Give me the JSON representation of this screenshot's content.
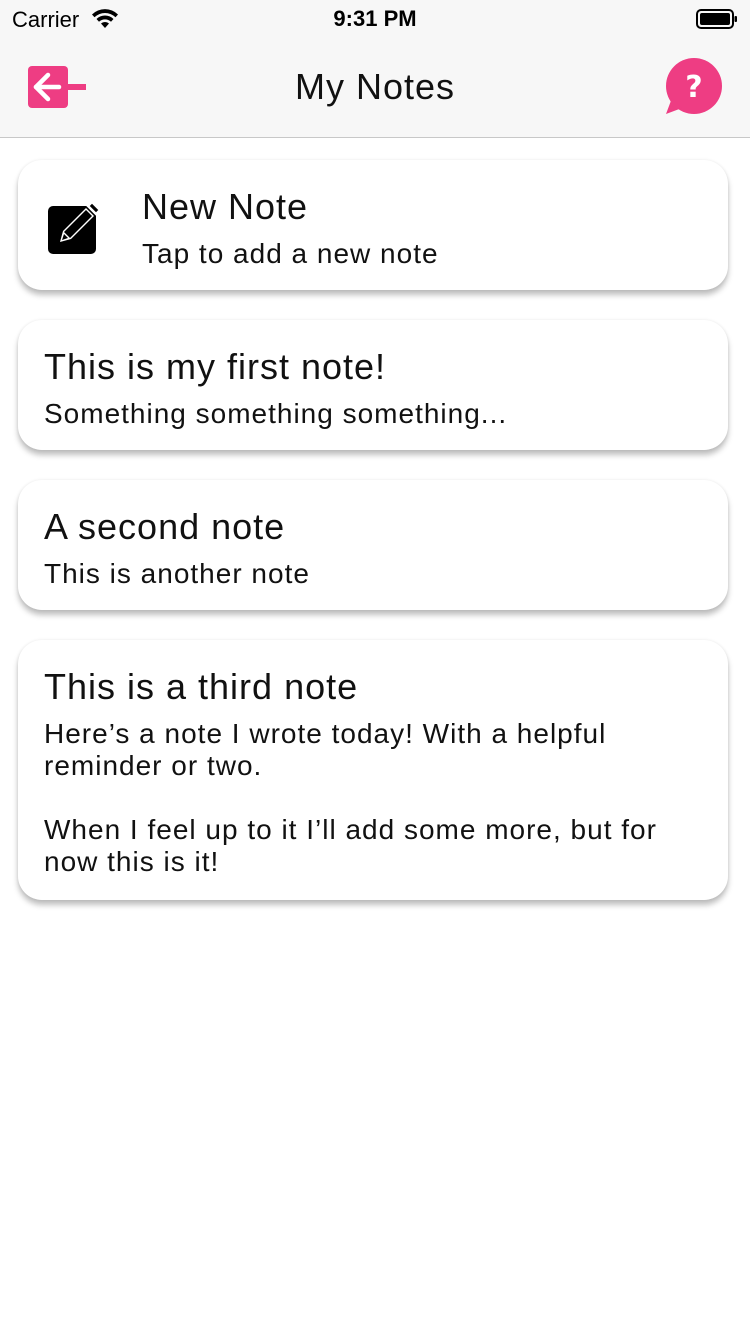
{
  "status_bar": {
    "carrier": "Carrier",
    "time": "9:31 PM",
    "icons": [
      "wifi-icon",
      "battery-icon"
    ]
  },
  "nav": {
    "title": "My Notes",
    "back_icon": "exit-arrow-icon",
    "help_icon": "question-bubble-icon",
    "accent_color": "#ee3d83"
  },
  "new_note": {
    "title": "New Note",
    "subtitle": "Tap to add a new note",
    "icon": "compose-icon"
  },
  "notes": [
    {
      "title": "This is my first note!",
      "body": "Something something something..."
    },
    {
      "title": "A second note",
      "body": "This is another note"
    },
    {
      "title": "This is a third note",
      "body": "Here’s a note I wrote today! With a helpful reminder or two.\n\nWhen I feel up to it I’ll add some more, but for now this is it!"
    }
  ]
}
